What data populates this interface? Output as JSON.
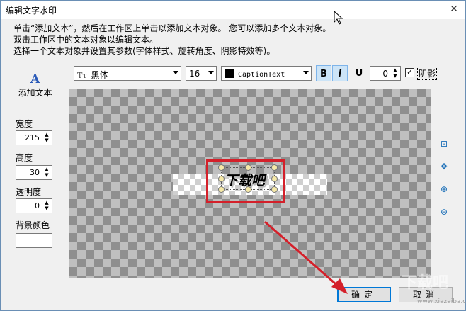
{
  "window": {
    "title": "编辑文字水印",
    "close_glyph": "✕"
  },
  "instructions": [
    "单击“添加文本”，然后在工作区上单击以添加文本对象。 您可以添加多个文本对象。",
    "双击工作区中的文本对象以编辑文本。",
    "选择一个文本对象并设置其参数(字体样式、旋转角度、阴影特效等)。"
  ],
  "left_panel": {
    "add_text_icon": "A",
    "add_text_label": "添加文本",
    "width_label": "宽度",
    "width_value": "215",
    "height_label": "高度",
    "height_value": "30",
    "opacity_label": "透明度",
    "opacity_value": "0",
    "bgcolor_label": "背景颜色"
  },
  "toolbar": {
    "font_icon": "Tт",
    "font_name": "黑体",
    "font_size": "16",
    "color_name": "CaptionText",
    "bold": "B",
    "italic": "I",
    "underline": "U",
    "rotation": "0",
    "shadow_label": "阴影",
    "shadow_checked": true
  },
  "canvas": {
    "watermark_text": "下载吧"
  },
  "side_tools": {
    "fit": "⊡",
    "move": "✥",
    "zoom_in": "⊕",
    "zoom_out": "⊖"
  },
  "buttons": {
    "ok": "确定",
    "cancel": "取消"
  },
  "colors": {
    "annotation_red": "#d4202a",
    "accent_blue": "#0078d7"
  },
  "site_watermark": {
    "logo": "下载吧",
    "url": "www.xiazaiba.com"
  }
}
